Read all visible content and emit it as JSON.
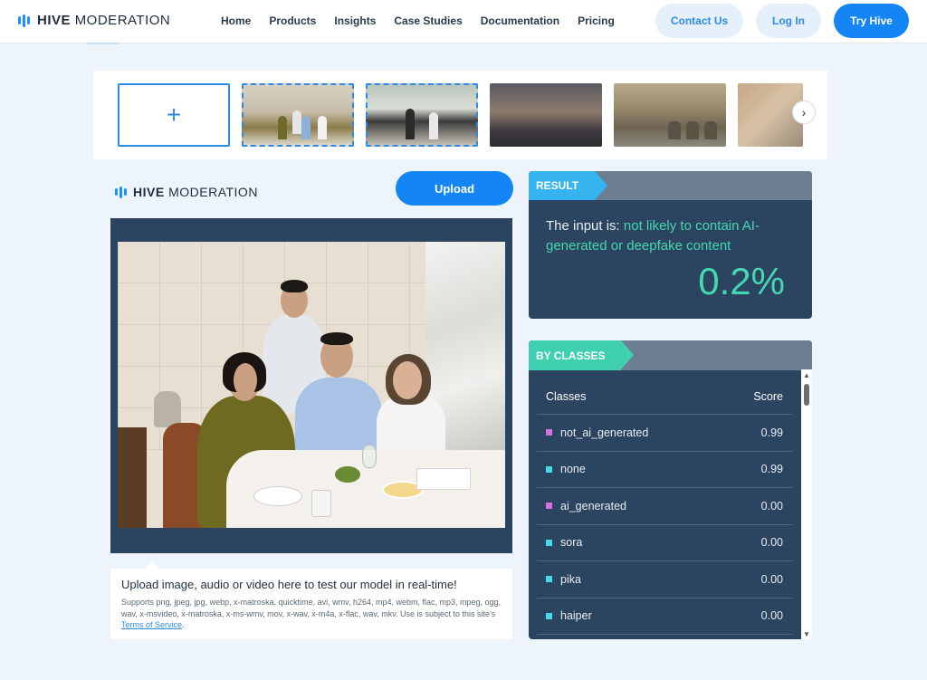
{
  "nav": {
    "logo_bold": "HIVE",
    "logo_rest": "MODERATION",
    "links": [
      "Home",
      "Products",
      "Insights",
      "Case Studies",
      "Documentation",
      "Pricing"
    ],
    "contact_label": "Contact Us",
    "login_label": "Log In",
    "try_label": "Try Hive"
  },
  "strip": {
    "add_symbol": "+",
    "next_symbol": "›"
  },
  "left": {
    "logo_bold": "HIVE",
    "logo_rest": "MODERATION",
    "upload_label": "Upload",
    "caption_title": "Upload image, audio or video here to test our model in real-time!",
    "caption_text": "Supports png, jpeg, jpg, webp, x-matroska, quicktime, avi, wmv, h264, mp4, webm, flac, mp3, mpeg, ogg, wav, x-msvideo, x-matroska, x-ms-wmv, mov, x-wav, x-m4a, x-flac, wav, mkv. Use is subject to this site's",
    "terms_label": "Terms of Service",
    "caption_end": "."
  },
  "result": {
    "tag": "RESULT",
    "prefix": "The input is: ",
    "verdict": "not likely to contain AI-generated or deepfake content",
    "score": "0.2%"
  },
  "classes": {
    "tag": "BY CLASSES",
    "header_class": "Classes",
    "header_score": "Score",
    "rows": [
      {
        "name": "not_ai_generated",
        "score": "0.99",
        "color": "#d96ee0"
      },
      {
        "name": "none",
        "score": "0.99",
        "color": "#46d9e6"
      },
      {
        "name": "ai_generated",
        "score": "0.00",
        "color": "#d96ee0"
      },
      {
        "name": "sora",
        "score": "0.00",
        "color": "#46d9e6"
      },
      {
        "name": "pika",
        "score": "0.00",
        "color": "#46d9e6"
      },
      {
        "name": "haiper",
        "score": "0.00",
        "color": "#46d9e6"
      }
    ]
  },
  "colors": {
    "accent": "#1485f5",
    "panel": "#2b4560",
    "highlight": "#45d6b3"
  }
}
